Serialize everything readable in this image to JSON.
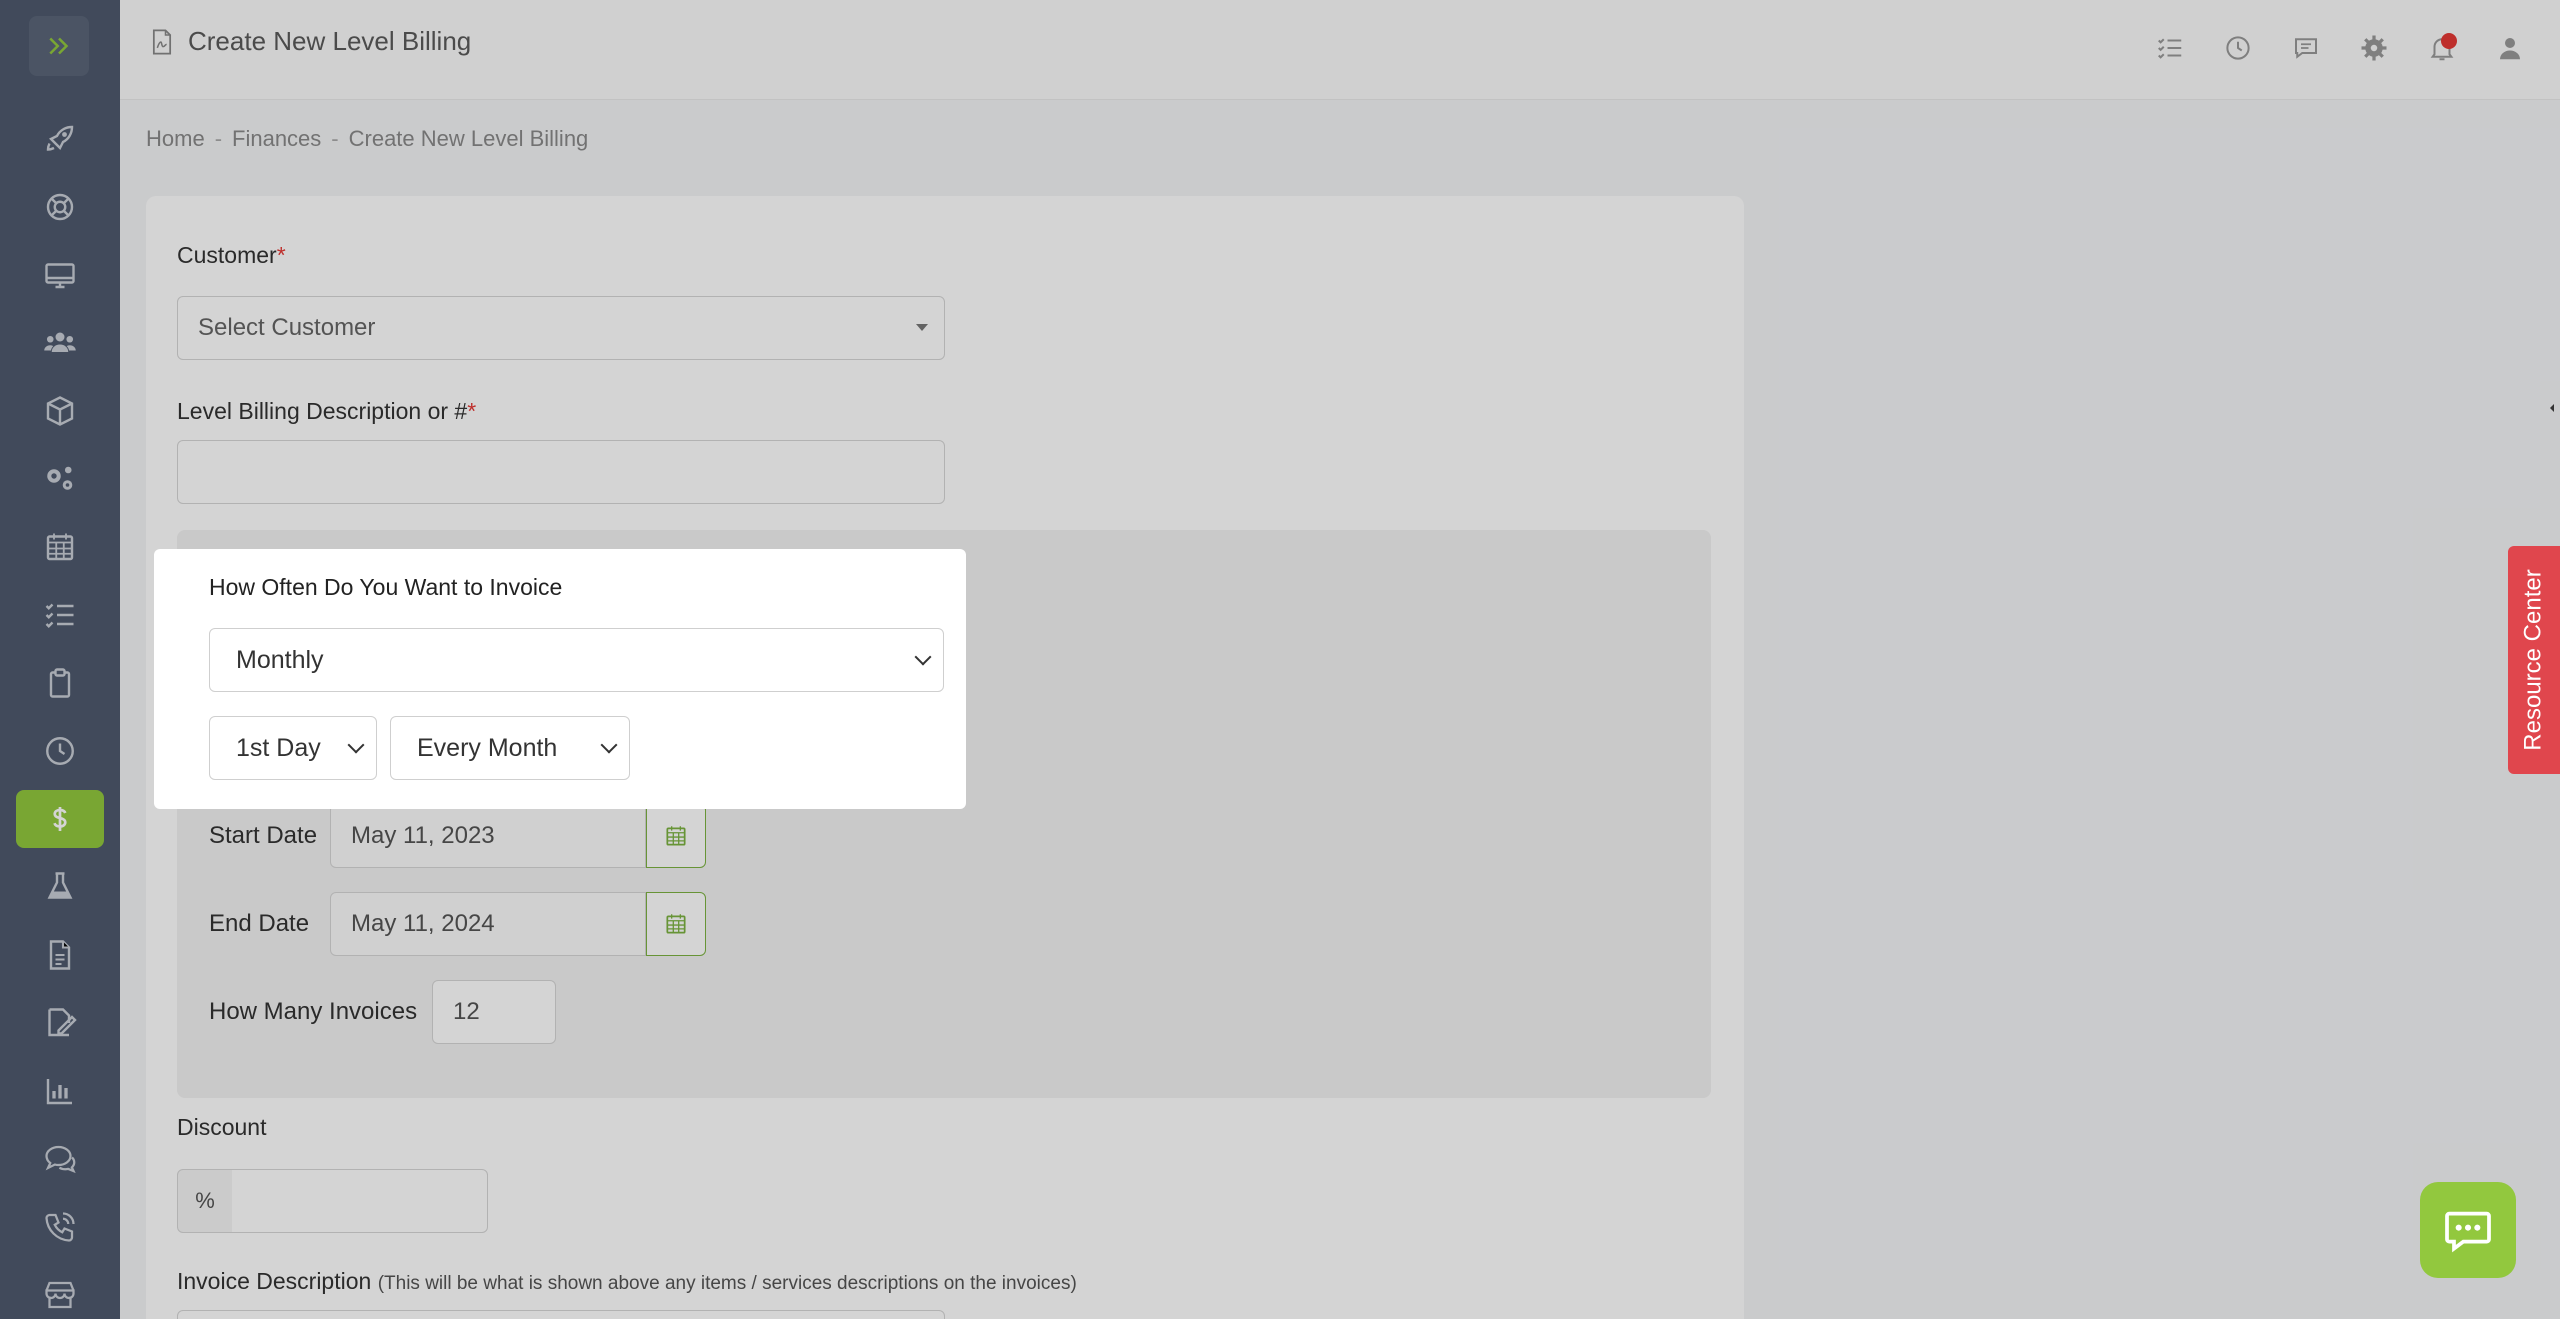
{
  "header": {
    "title": "Create New Level Billing"
  },
  "breadcrumb": {
    "items": [
      "Home",
      "Finances",
      "Create New Level Billing"
    ],
    "separator": "-"
  },
  "form": {
    "customer_label": "Customer",
    "required_mark": "*",
    "customer_placeholder": "Select Customer",
    "description_label": "Level Billing Description or #",
    "start_date_label": "Start Date",
    "start_date_value": "May 11, 2023",
    "end_date_label": "End Date",
    "end_date_value": "May 11, 2024",
    "invoices_label": "How Many Invoices",
    "invoices_value": "12",
    "discount_label": "Discount",
    "discount_addon": "%",
    "invoice_desc_label": "Invoice Description",
    "invoice_desc_note": "(This will be what is shown above any items / services descriptions on the invoices)"
  },
  "frequency": {
    "label": "How Often Do You Want to Invoice",
    "selected": "Monthly",
    "day_selected": "1st Day",
    "period_selected": "Every Month"
  },
  "resource_center": {
    "label": "Resource Center"
  },
  "sidebar_icons": [
    "expand-icon",
    "rocket-icon",
    "lifebuoy-icon",
    "monitor-icon",
    "users-icon",
    "box-icon",
    "gears-icon",
    "calendar-icon",
    "checklist-icon",
    "clipboard-icon",
    "clock-icon",
    "dollar-icon",
    "flask-icon",
    "document-icon",
    "signature-icon",
    "chart-icon",
    "chat-icon",
    "phone-icon",
    "store-icon"
  ],
  "colors": {
    "sidebar_bg": "#4f5a6e",
    "accent_green": "#92c83e",
    "resource_red": "#e0464d"
  }
}
